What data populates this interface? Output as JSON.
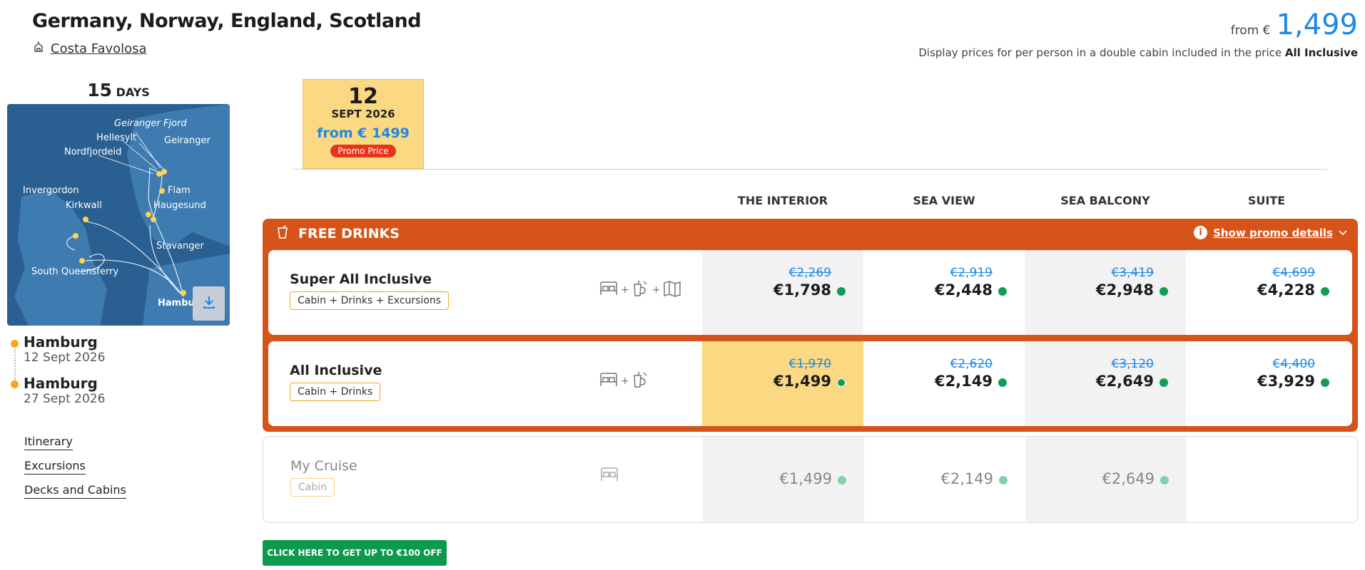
{
  "header": {
    "title": "Germany, Norway, England, Scotland",
    "ship_name": "Costa Favolosa",
    "from_label": "from €",
    "from_value": "1,499",
    "display_note_prefix": "Display prices for per person in a double cabin included in the price",
    "display_note_bold": "All Inclusive"
  },
  "trip": {
    "days_number": "15",
    "days_unit": "DAYS",
    "map_labels": [
      "Geiranger Fjord",
      "Hellesylt",
      "Geiranger",
      "Nordfjordeid",
      "Flam",
      "Invergordon",
      "Kirkwall",
      "Haugesund",
      "Stavanger",
      "South Queensferry",
      "Hamburg"
    ],
    "stops": [
      {
        "name": "Hamburg",
        "date": "12 Sept 2026"
      },
      {
        "name": "Hamburg",
        "date": "27 Sept 2026"
      }
    ],
    "links": [
      "Itinerary",
      "Excursions",
      "Decks and Cabins"
    ]
  },
  "date_tab": {
    "day": "12",
    "month": "SEPT 2026",
    "price": "from € 1499",
    "badge": "Promo Price"
  },
  "cabin_columns": [
    "THE INTERIOR",
    "SEA VIEW",
    "SEA BALCONY",
    "SUITE"
  ],
  "promo": {
    "title": "FREE DRINKS",
    "details_link": "Show promo details",
    "info_icon": "i"
  },
  "packages": [
    {
      "name": "Super All Inclusive",
      "tag": "Cabin + Drinks + Excursions",
      "icons": [
        "bed-icon",
        "drink-icon",
        "map-icon"
      ],
      "prices": [
        {
          "old": "€2,269",
          "new": "€1,798"
        },
        {
          "old": "€2,919",
          "new": "€2,448"
        },
        {
          "old": "€3,419",
          "new": "€2,948"
        },
        {
          "old": "€4,699",
          "new": "€4,228"
        }
      ]
    },
    {
      "name": "All Inclusive",
      "tag": "Cabin + Drinks",
      "icons": [
        "bed-icon",
        "drink-icon"
      ],
      "prices": [
        {
          "old": "€1,970",
          "new": "€1,499"
        },
        {
          "old": "€2,620",
          "new": "€2,149"
        },
        {
          "old": "€3,120",
          "new": "€2,649"
        },
        {
          "old": "€4,400",
          "new": "€3,929"
        }
      ]
    },
    {
      "name": "My Cruise",
      "tag": "Cabin",
      "icons": [
        "bed-icon"
      ],
      "prices": [
        {
          "new": "€1,499"
        },
        {
          "new": "€2,149"
        },
        {
          "new": "€2,649"
        }
      ]
    }
  ],
  "plus_sign": "+",
  "cta_label": "CLICK HERE TO GET UP TO €100 OFF",
  "colors": {
    "accent_blue": "#1e88e5",
    "promo_orange": "#d5541a",
    "selected_yellow": "#fad982",
    "available_green": "#0f9d58",
    "cta_green": "#0b9a4e"
  }
}
